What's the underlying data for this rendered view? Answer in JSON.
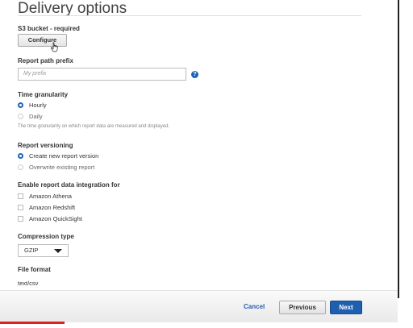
{
  "page": {
    "title": "Delivery options"
  },
  "s3_bucket": {
    "label": "S3 bucket - required",
    "configure_label": "Configure"
  },
  "report_path_prefix": {
    "label": "Report path prefix",
    "placeholder": "My prefix",
    "info_icon": "?"
  },
  "time_granularity": {
    "label": "Time granularity",
    "options": [
      {
        "label": "Hourly",
        "selected": true
      },
      {
        "label": "Daily",
        "selected": false
      }
    ],
    "help": "The time granularity on which report data are measured and displayed."
  },
  "report_versioning": {
    "label": "Report versioning",
    "options": [
      {
        "label": "Create new report version",
        "selected": true
      },
      {
        "label": "Overwrite existing report",
        "selected": false
      }
    ]
  },
  "integration": {
    "label": "Enable report data integration for",
    "options": [
      {
        "label": "Amazon Athena",
        "checked": false
      },
      {
        "label": "Amazon Redshift",
        "checked": false
      },
      {
        "label": "Amazon QuickSight",
        "checked": false
      }
    ]
  },
  "compression": {
    "label": "Compression type",
    "value": "GZIP"
  },
  "file_format": {
    "label": "File format",
    "value": "text/csv"
  },
  "footer": {
    "cancel_label": "Cancel",
    "previous_label": "Previous",
    "next_label": "Next"
  },
  "colors": {
    "accent": "#1f5fb0",
    "progress": "#e02020"
  },
  "icons": {
    "cursor": "hand-pointer-icon",
    "info": "info-icon",
    "dropdown": "caret-down-icon"
  }
}
